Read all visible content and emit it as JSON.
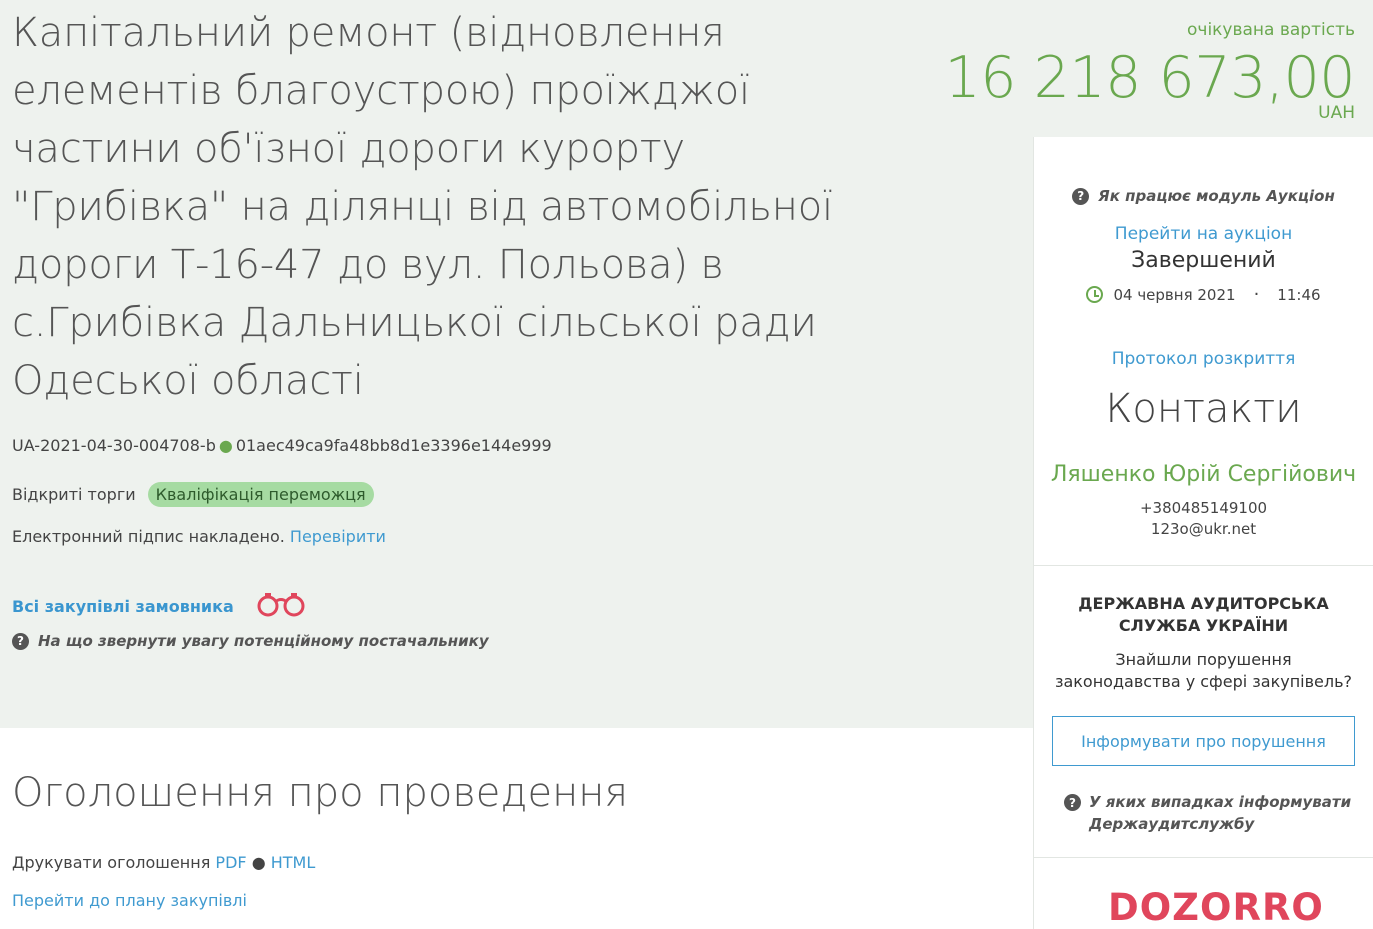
{
  "tender": {
    "title": "Капітальний ремонт (відновлення елементів благоустрою) проїжджої частини об'їзної дороги курорту \"Грибівка\" на ділянці від автомобільної дороги Т-16-47 до вул. Польова) в с.Грибівка Дальницької сільської ради Одеської області",
    "id": "UA-2021-04-30-004708-b",
    "hash": "01aec49ca9fa48bb8d1e3396e144e999",
    "procedure_type": "Відкриті торги",
    "status": "Кваліфікація переможця",
    "signature_text": "Електронний підпис накладено.",
    "signature_check_link": "Перевірити",
    "all_purchases_link": "Всі закупівлі замовника",
    "supplier_hint": "На що звернути увагу потенційному постачальнику"
  },
  "price": {
    "label": "очікувана вартість",
    "value": "16 218 673,00",
    "currency": "UAH"
  },
  "auction": {
    "help": "Як працює модуль Аукціон",
    "link": "Перейти на аукціон",
    "status": "Завершений",
    "date": "04 червня 2021",
    "time": "11:46",
    "protocol_link": "Протокол розкриття"
  },
  "contacts": {
    "title": "Контакти",
    "name": "Ляшенко Юрій Сергійович",
    "phone": "+380485149100",
    "email": "123o@ukr.net"
  },
  "audit": {
    "title_line1": "ДЕРЖАВНА АУДИТОРСЬКА",
    "title_line2": "СЛУЖБА УКРАЇНИ",
    "text_line1": "Знайшли порушення",
    "text_line2": "законодавства у сфері закупівель?",
    "button": "Інформувати про порушення",
    "help_line1": "У яких випадках інформувати",
    "help_line2": "Держаудитслужбу"
  },
  "announcement": {
    "title": "Оголошення про проведення",
    "print_label": "Друкувати оголошення",
    "pdf": "PDF",
    "html": "HTML",
    "plan_link": "Перейти до плану закупівлі"
  },
  "brand": {
    "dozorro": "DOZORRO"
  },
  "colors": {
    "accent_green": "#6aa84f",
    "link_blue": "#3f9ad0",
    "status_pill": "#a6dba2",
    "dozorro_red": "#e0465c",
    "hero_background": "#eef2ee"
  },
  "icons": [
    "question-icon",
    "clock-icon",
    "binoculars-icon"
  ]
}
